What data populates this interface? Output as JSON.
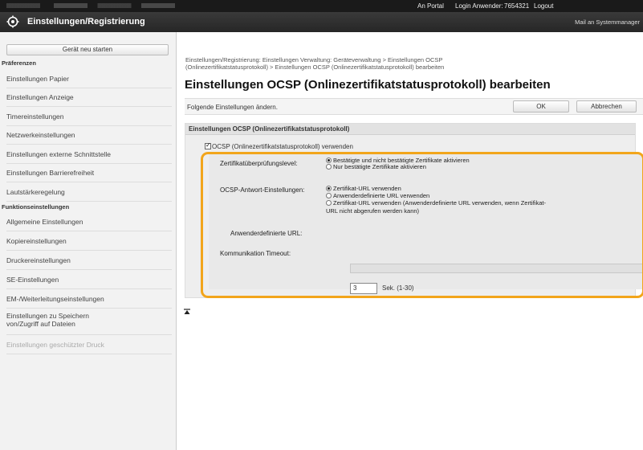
{
  "topbar": {
    "portal": "An Portal",
    "login_label": "Login Anwender:",
    "login_value": "7654321",
    "logout": "Logout"
  },
  "header": {
    "app_title": "Einstellungen/Registrierung",
    "mail": "Mail an Systemmanager"
  },
  "sidebar": {
    "restart": "Gerät neu starten",
    "section_pref": "Präferenzen",
    "pref_items": [
      "Einstellungen Papier",
      "Einstellungen Anzeige",
      "Timereinstellungen",
      "Netzwerkeinstellungen",
      "Einstellungen externe Schnittstelle",
      "Einstellungen Barrierefreiheit",
      "Lautstärkeregelung"
    ],
    "section_func": "Funktionseinstellungen",
    "func_items": [
      "Allgemeine Einstellungen",
      "Kopiereinstellungen",
      "Druckereinstellungen",
      "SE-Einstellungen",
      "EM-/Weiterleitungseinstellungen"
    ],
    "two_line_item": [
      "Einstellungen zu Speichern",
      "von/Zugriff auf Dateien"
    ],
    "faded_item": "Einstellungen geschützter Druck"
  },
  "main": {
    "breadcrumb_line1": "Einstellungen/Registrierung: Einstellungen Verwaltung: Geräteverwaltung > Einstellungen OCSP",
    "breadcrumb_line2": "(Onlinezertifikatstatusprotokoll) > Einstellungen OCSP (Onlinezertifikatstatusprotokoll) bearbeiten",
    "page_title": "Einstellungen OCSP (Onlinezertifikatstatusprotokoll) bearbeiten",
    "instruction": "Folgende Einstellungen ändern.",
    "ok": "OK",
    "cancel": "Abbrechen",
    "section_title": "Einstellungen OCSP (Onlinezertifikatstatusprotokoll)",
    "use_ocsp_label": "OCSP (Onlinezertifikatstatusprotokoll) verwenden",
    "use_ocsp_checked": true,
    "verify_level_label": "Zertifikatüberprüfungslevel:",
    "verify_opts": [
      "Bestätigte und nicht bestätigte Zertifikate aktivieren",
      "Nur bestätigte Zertifikate aktivieren"
    ],
    "verify_selected": 0,
    "response_label": "OCSP-Antwort-Einstellungen:",
    "response_opts": [
      "Zertifikat-URL verwenden",
      "Anwenderdefinierte URL verwenden",
      "Zertifikat-URL verwenden (Anwenderdefinierte URL verwenden, wenn Zertifikat-"
    ],
    "response_opt3_wrap": "URL nicht abgerufen werden kann)",
    "response_selected": 0,
    "custom_url_label": "Anwenderdefinierte URL:",
    "custom_url_value": "",
    "timeout_label": "Kommunikation Timeout:",
    "timeout_value": "3",
    "timeout_unit": "Sek. (1-30)",
    "highlight_color": "#f2a51b"
  }
}
